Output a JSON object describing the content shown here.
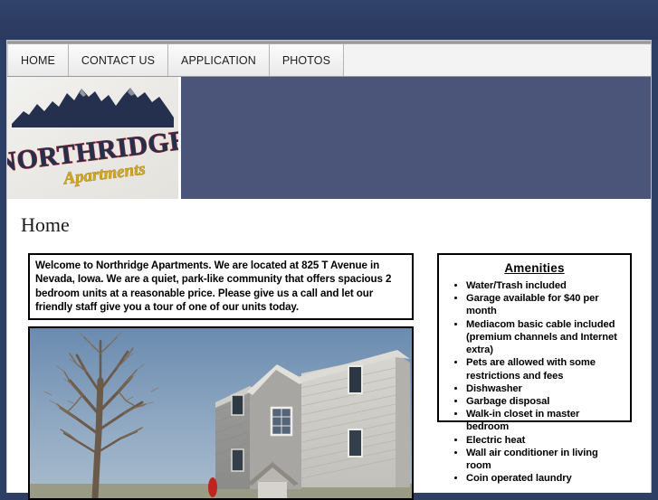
{
  "colors": {
    "top_band": "#2e3f66",
    "banner": "#4a5579",
    "nav_background": "#f3f3f3",
    "page_background": "#ffffff",
    "text": "#000000",
    "logo_navy": "#25304f",
    "logo_gold": "#d4a81c",
    "logo_red": "#9e2b2b"
  },
  "nav": {
    "items": [
      {
        "label": "HOME",
        "name": "nav-tab-home"
      },
      {
        "label": "CONTACT US",
        "name": "nav-tab-contact-us"
      },
      {
        "label": "APPLICATION",
        "name": "nav-tab-application"
      },
      {
        "label": "PHOTOS",
        "name": "nav-tab-photos"
      }
    ]
  },
  "logo": {
    "primary_text": "NORTHRIDGE",
    "secondary_text": "Apartments",
    "alt": "Northridge Apartments logo with mountain range"
  },
  "page": {
    "title": "Home"
  },
  "welcome": {
    "text": "Welcome to Northridge Apartments. We are located at 825 T Avenue in Nevada, Iowa. We are a quiet, park-like community that offers spacious 2 bedroom units at a reasonable price. Please give us a call and let our friendly staff give you a tour of one of our units today."
  },
  "photo": {
    "alt": "Exterior photo of a three-story gray-sided apartment building with a bare tree and blue sky"
  },
  "amenities": {
    "title": "Amenities",
    "items": [
      "Water/Trash included",
      "Garage available for $40 per month",
      "Mediacom basic cable included (premium channels and Internet extra)",
      "Pets are allowed with some restrictions and fees",
      "Dishwasher",
      "Garbage disposal",
      "Walk-in closet in master bedroom",
      "Electric heat",
      "Wall air conditioner in living room",
      "Coin operated laundry"
    ]
  }
}
